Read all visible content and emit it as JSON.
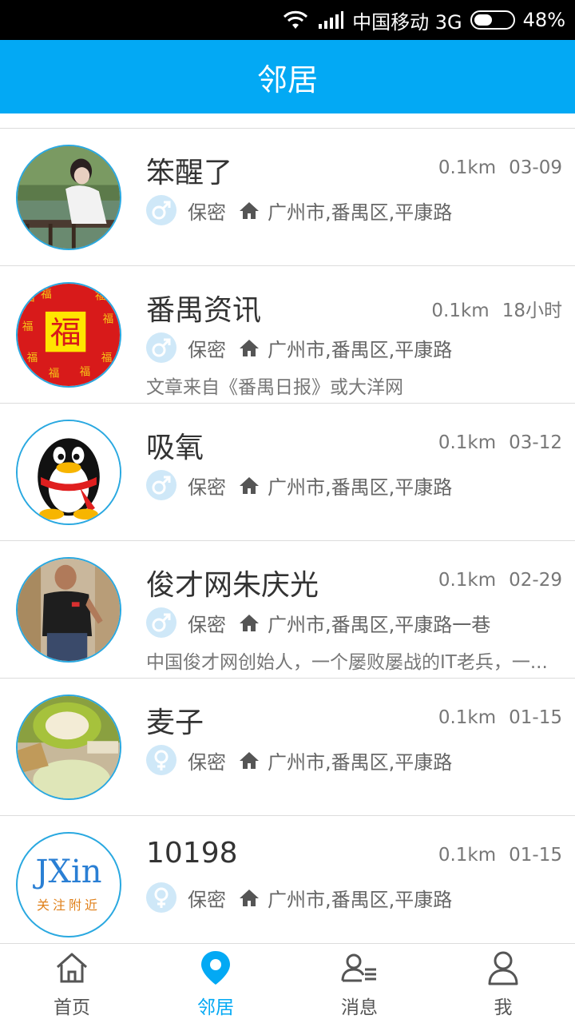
{
  "status_bar": {
    "carrier": "中国移动 3G",
    "battery": "48%",
    "battery_level": 0.48
  },
  "header": {
    "title": "邻居"
  },
  "neighbors": [
    {
      "name": "笨醒了",
      "distance": "0.1km",
      "time": "03-09",
      "gender": "male",
      "privacy": "保密",
      "location": "广州市,番禺区,平康路",
      "description": ""
    },
    {
      "name": "番禺资讯",
      "distance": "0.1km",
      "time": "18小时",
      "gender": "male",
      "privacy": "保密",
      "location": "广州市,番禺区,平康路",
      "description": "文章来自《番禺日报》或大洋网"
    },
    {
      "name": "吸氧",
      "distance": "0.1km",
      "time": "03-12",
      "gender": "male",
      "privacy": "保密",
      "location": "广州市,番禺区,平康路",
      "description": ""
    },
    {
      "name": "俊才网朱庆光",
      "distance": "0.1km",
      "time": "02-29",
      "gender": "male",
      "privacy": "保密",
      "location": "广州市,番禺区,平康路一巷",
      "description": "中国俊才网创始人，一个屡败屡战的IT老兵，一..."
    },
    {
      "name": "麦子",
      "distance": "0.1km",
      "time": "01-15",
      "gender": "female",
      "privacy": "保密",
      "location": "广州市,番禺区,平康路",
      "description": ""
    },
    {
      "name": "10198",
      "distance": "0.1km",
      "time": "01-15",
      "gender": "female",
      "privacy": "保密",
      "location": "广州市,番禺区,平康路",
      "description": "",
      "avatar_text": "JXin",
      "avatar_subtext": "关注附近"
    }
  ],
  "tabs": [
    {
      "label": "首页",
      "icon": "home-icon",
      "active": false
    },
    {
      "label": "邻居",
      "icon": "location-pin-icon",
      "active": true
    },
    {
      "label": "消息",
      "icon": "message-icon",
      "active": false
    },
    {
      "label": "我",
      "icon": "person-icon",
      "active": false
    }
  ],
  "colors": {
    "accent": "#03a9f4",
    "gender_bg": "#cfe8f8"
  }
}
